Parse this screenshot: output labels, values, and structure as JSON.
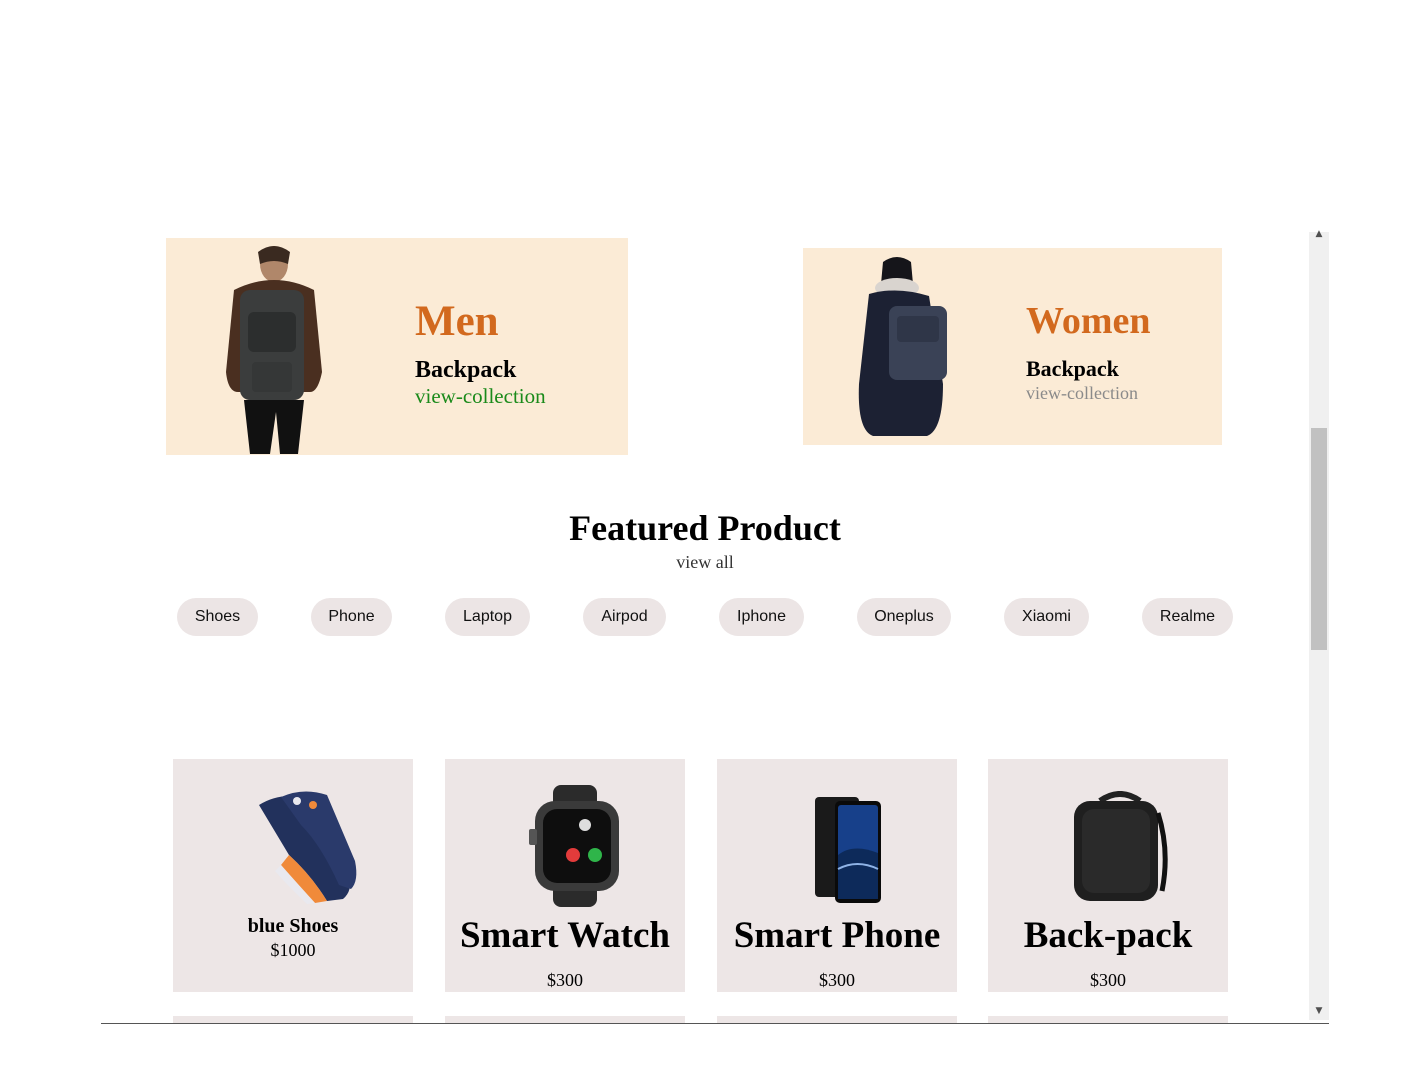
{
  "banners": {
    "men": {
      "title": "Men",
      "subtitle": "Backpack",
      "link": "view-collection",
      "link_color": "#1a8a1a"
    },
    "women": {
      "title": "Women",
      "subtitle": "Backpack",
      "link": "view-collection",
      "link_color": "#8a8a8a"
    },
    "title_color": "#d2691e",
    "background": "#fbebd6"
  },
  "featured": {
    "title": "Featured Product",
    "view_all": "view all"
  },
  "categories": [
    "Shoes",
    "Phone",
    "Laptop",
    "Airpod",
    "Iphone",
    "Oneplus",
    "Xiaomi",
    "Realme"
  ],
  "products": [
    {
      "name": "blue Shoes",
      "price": "$1000",
      "icon": "sneaker-icon"
    },
    {
      "name": "Smart Watch",
      "price": "$300",
      "icon": "smartwatch-icon"
    },
    {
      "name": "Smart Phone",
      "price": "$300",
      "icon": "smartphone-icon"
    },
    {
      "name": "Back-pack",
      "price": "$300",
      "icon": "backpack-icon"
    }
  ]
}
